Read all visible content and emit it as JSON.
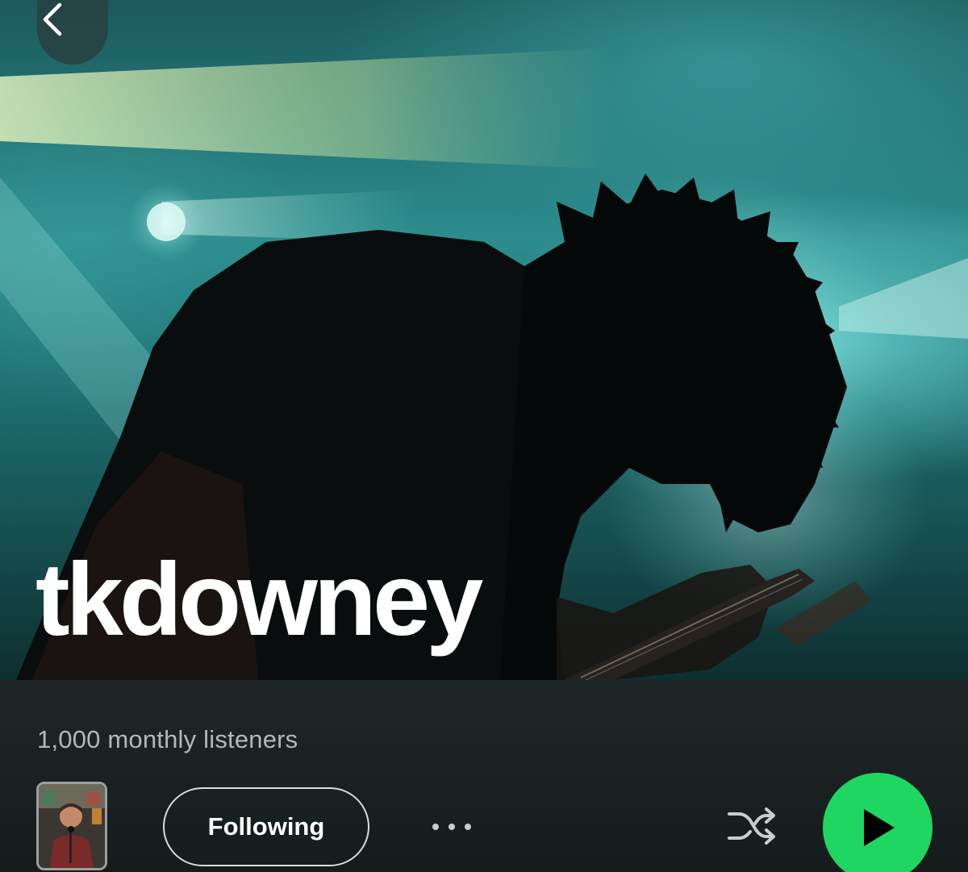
{
  "header": {
    "back_icon": "chevron-left-icon"
  },
  "artist": {
    "name": "tkdowney",
    "monthly_listeners": "1,000 monthly listeners"
  },
  "actions": {
    "follow_label": "Following",
    "more_icon": "more-horizontal-icon",
    "shuffle_icon": "shuffle-icon",
    "play_icon": "play-icon"
  },
  "colors": {
    "accent": "#1ed760",
    "background": "#161c1d",
    "text_secondary": "#b3b8b8"
  }
}
